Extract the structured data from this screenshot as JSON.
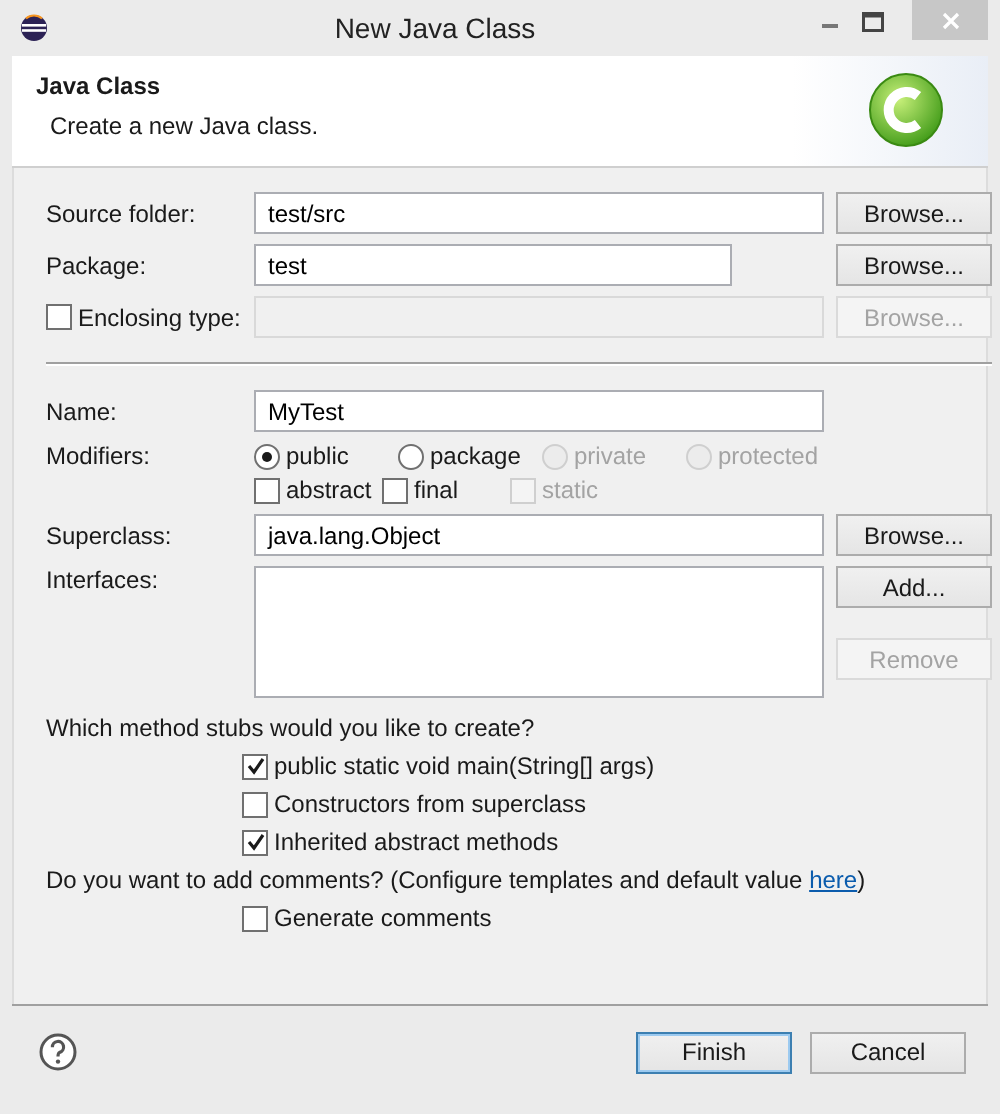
{
  "window": {
    "title": "New Java Class"
  },
  "header": {
    "title": "Java Class",
    "message": "Create a new Java class."
  },
  "source_folder": {
    "label": "Source folder:",
    "value": "test/src",
    "button": {
      "label": "Browse...",
      "disabled": false
    }
  },
  "package": {
    "label": "Package:",
    "value": "test",
    "button": {
      "label": "Browse...",
      "disabled": false
    }
  },
  "enclosing_type": {
    "label": "Enclosing type:",
    "checked": false,
    "disabled": true,
    "button": {
      "label": "Browse...",
      "disabled": true
    }
  },
  "name": {
    "label": "Name:",
    "value": "MyTest"
  },
  "modifiers": {
    "label": "Modifiers:",
    "access": [
      {
        "label": "public",
        "selected": true,
        "disabled": false
      },
      {
        "label": "package",
        "selected": false,
        "disabled": false
      },
      {
        "label": "private",
        "selected": false,
        "disabled": true
      },
      {
        "label": "protected",
        "selected": false,
        "disabled": true
      }
    ],
    "flags": [
      {
        "label": "abstract",
        "checked": false,
        "disabled": false
      },
      {
        "label": "final",
        "checked": false,
        "disabled": false
      },
      {
        "label": "static",
        "checked": false,
        "disabled": true
      }
    ]
  },
  "superclass": {
    "label": "Superclass:",
    "value": "java.lang.Object",
    "button": {
      "label": "Browse...",
      "disabled": false
    }
  },
  "interfaces": {
    "label": "Interfaces:",
    "buttons": [
      {
        "label": "Add...",
        "disabled": false
      },
      {
        "label": "Remove",
        "disabled": true
      }
    ]
  },
  "method_stubs": {
    "question": "Which method stubs would you like to create?",
    "options": [
      {
        "label": "public static void main(String[] args)",
        "checked": true
      },
      {
        "label": "Constructors from superclass",
        "checked": false
      },
      {
        "label": "Inherited abstract methods",
        "checked": true
      }
    ]
  },
  "comments": {
    "question": "Do you want to add comments? (Configure templates and default value ",
    "link": "here",
    "question_end": ")",
    "options": [
      {
        "label": "Generate comments",
        "checked": false
      }
    ]
  },
  "footer": {
    "buttons": [
      {
        "label": "Finish",
        "default": true
      },
      {
        "label": "Cancel",
        "default": false
      }
    ]
  }
}
